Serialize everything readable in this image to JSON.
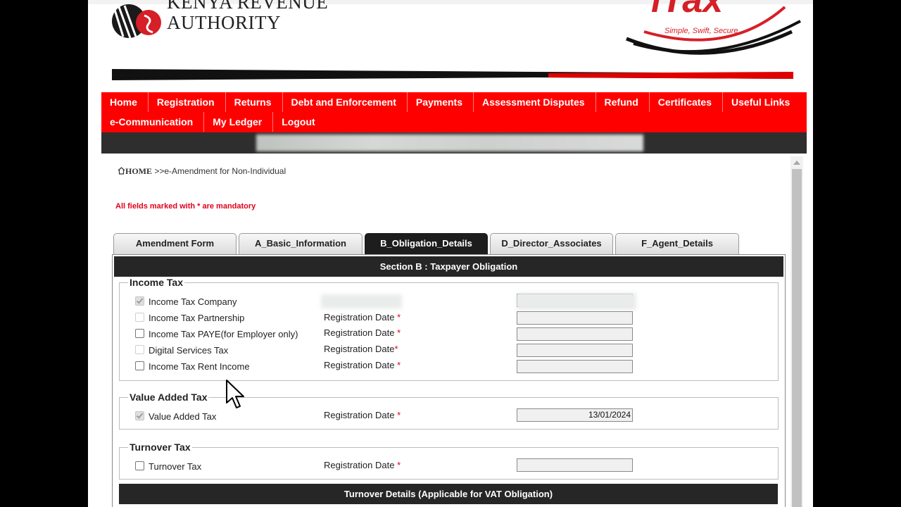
{
  "header": {
    "org_line1": "Kenya Revenue",
    "org_line2": "Authority",
    "itax_word": "iTax",
    "itax_tagline": "Simple, Swift, Secure"
  },
  "nav": {
    "row1": [
      "Home",
      "Registration",
      "Returns",
      "Debt and Enforcement",
      "Payments",
      "Assessment Disputes",
      "Refund",
      "Certificates",
      "Useful Links"
    ],
    "row2": [
      "e-Communication",
      "My Ledger",
      "Logout"
    ]
  },
  "breadcrumb": {
    "home": "HOME",
    "current": ">>e-Amendment for Non-Individual"
  },
  "mandatory_note": "All fields marked with * are mandatory",
  "tabs": [
    "Amendment Form",
    "A_Basic_Information",
    "B_Obligation_Details",
    "D_Director_Associates",
    "F_Agent_Details"
  ],
  "active_tab": "B_Obligation_Details",
  "section_title": "Section B : Taxpayer Obligation",
  "income_tax": {
    "legend": "Income Tax",
    "rows": [
      {
        "label": "Income Tax Company",
        "date_label": "",
        "value": ""
      },
      {
        "label": "Income Tax Partnership",
        "date_label": "Registration Date",
        "value": ""
      },
      {
        "label": "Income Tax PAYE(for Employer only)",
        "date_label": "Registration Date",
        "value": ""
      },
      {
        "label": "Digital Services Tax",
        "date_label": "Registration Date",
        "value": ""
      },
      {
        "label": "Income Tax Rent Income",
        "date_label": "Registration Date",
        "value": ""
      }
    ]
  },
  "vat": {
    "legend": "Value Added Tax",
    "label": "Value Added Tax",
    "date_label": "Registration Date",
    "value": "13/01/2024"
  },
  "turnover_tax": {
    "legend": "Turnover Tax",
    "label": "Turnover Tax",
    "date_label": "Registration Date",
    "value": ""
  },
  "turnover_details_title": "Turnover Details (Applicable for VAT Obligation)",
  "required_mark": "*",
  "colors": {
    "brand_red": "#ff0000",
    "dark_bar": "#2e2e2e",
    "section_header": "#262626",
    "required": "#e0001b"
  }
}
